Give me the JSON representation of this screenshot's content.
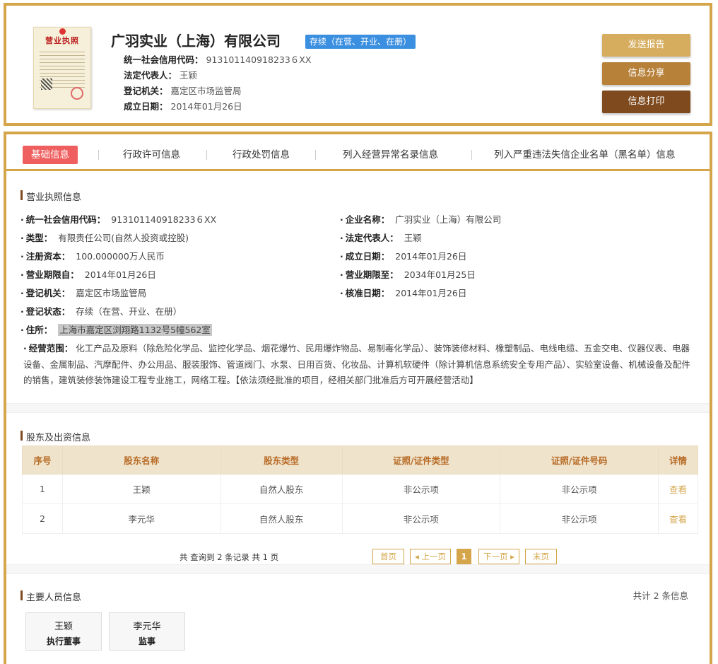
{
  "header": {
    "license_image": {
      "title": "营业执照"
    },
    "company_name": "广羽实业（上海）有限公司",
    "status_badge": "存续（在营、开业、在册）",
    "fields": [
      {
        "label": "统一社会信用代码：",
        "value": "913101140918233６XX"
      },
      {
        "label": "法定代表人：",
        "value": "王颖"
      },
      {
        "label": "登记机关：",
        "value": "嘉定区市场监管局"
      },
      {
        "label": "成立日期：",
        "value": "2014年01月26日"
      }
    ],
    "buttons": {
      "send": "发送报告",
      "share": "信息分享",
      "print": "信息打印"
    }
  },
  "tabs": [
    {
      "label": "基础信息",
      "active": true
    },
    {
      "label": "行政许可信息"
    },
    {
      "label": "行政处罚信息"
    },
    {
      "label": "列入经营异常名录信息"
    },
    {
      "label": "列入严重违法失信企业名单（黑名单）信息"
    }
  ],
  "license_section": {
    "title": "营业执照信息",
    "left": [
      {
        "label": "统一社会信用代码：",
        "value": "913101140918233６XX"
      },
      {
        "label": "类型：",
        "value": "有限责任公司(自然人投资或控股)"
      },
      {
        "label": "注册资本：",
        "value": "100.000000万人民币"
      },
      {
        "label": "营业期限自：",
        "value": "2014年01月26日"
      },
      {
        "label": "登记机关：",
        "value": "嘉定区市场监管局"
      },
      {
        "label": "登记状态：",
        "value": "存续（在营、开业、在册）"
      },
      {
        "label": "住所：",
        "value": "上海市嘉定区浏翔路1132号5幢562室"
      }
    ],
    "right": [
      {
        "label": "企业名称：",
        "value": "广羽实业（上海）有限公司"
      },
      {
        "label": "法定代表人：",
        "value": "王颖"
      },
      {
        "label": "成立日期：",
        "value": "2014年01月26日"
      },
      {
        "label": "营业期限至：",
        "value": "2034年01月25日"
      },
      {
        "label": "核准日期：",
        "value": "2014年01月26日"
      }
    ],
    "scope_label": "经营范围：",
    "scope_value": "化工产品及原料（除危险化学品、监控化学品、烟花爆竹、民用爆炸物品、易制毒化学品）、装饰装修材料、橡塑制品、电线电缆、五金交电、仪器仪表、电器设备、金属制品、汽摩配件、办公用品、服装服饰、管道阀门、水泵、日用百货、化妆品、计算机软硬件（除计算机信息系统安全专用产品）、实验室设备、机械设备及配件的销售，建筑装修装饰建设工程专业施工，网络工程。【依法须经批准的项目，经相关部门批准后方可开展经营活动】"
  },
  "shareholders": {
    "title": "股东及出资信息",
    "columns": [
      "序号",
      "股东名称",
      "股东类型",
      "证照/证件类型",
      "证照/证件号码",
      "详情"
    ],
    "rows": [
      {
        "no": "1",
        "name": "王颖",
        "type": "自然人股东",
        "id_type": "非公示项",
        "id_no": "非公示项",
        "detail": "查看"
      },
      {
        "no": "2",
        "name": "李元华",
        "type": "自然人股东",
        "id_type": "非公示项",
        "id_no": "非公示项",
        "detail": "查看"
      }
    ],
    "records_text": "共 查询到 2 条记录 共 1 页",
    "pager": {
      "first": "首页",
      "prev": "◂ 上一页",
      "current": "1",
      "next": "下一页 ▸",
      "last": "末页"
    }
  },
  "staff": {
    "title": "主要人员信息",
    "total": "共计 2 条信息",
    "people": [
      {
        "name": "王颖",
        "role": "执行董事"
      },
      {
        "name": "李元华",
        "role": "监事"
      }
    ]
  }
}
